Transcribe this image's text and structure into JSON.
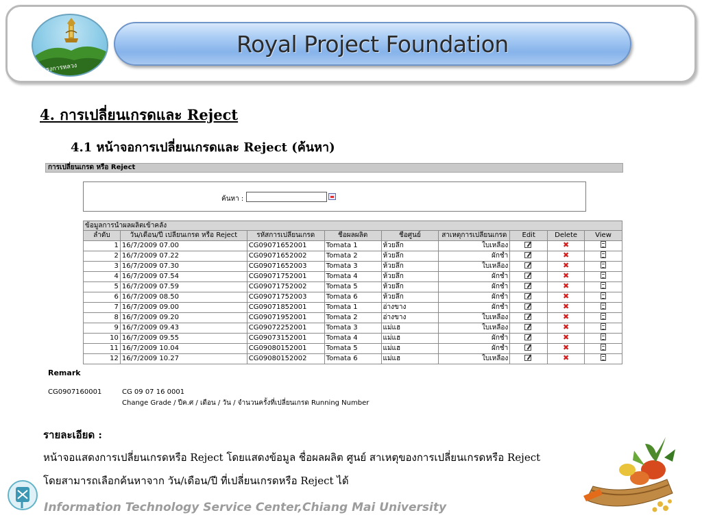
{
  "header": {
    "title": "Royal Project Foundation",
    "logo_text": "โครงการหลวง"
  },
  "headings": {
    "main": "4. การเปลี่ยนเกรดและ Reject",
    "sub": "4.1 หน้าจอการเปลี่ยนเกรดและ Reject (ค้นหา)"
  },
  "capture": {
    "title": "การเปลี่ยนเกรด หรือ Reject",
    "search_label": "ค้นหา :",
    "search_value": "",
    "table_caption": "ข้อมูลการนำผลผลิตเข้าคลัง",
    "columns": [
      "ลำดับ",
      "วัน/เดือน/ปี เปลี่ยนเกรด หรือ Reject",
      "รหัสการเปลี่ยนเกรด",
      "ชื่อผลผลิต",
      "ชื่อศูนย์",
      "สาเหตุการเปลี่ยนเกรด",
      "Edit",
      "Delete",
      "View"
    ],
    "rows": [
      {
        "no": "1",
        "date": "16/7/2009 07.00",
        "code": "CG09071652001",
        "product": "Tomata 1",
        "center": "ห้วยลึก",
        "reason": "ใบเหลือง"
      },
      {
        "no": "2",
        "date": "16/7/2009 07.22",
        "code": "CG09071652002",
        "product": "Tomata 2",
        "center": "ห้วยลึก",
        "reason": "ผักช้ำ"
      },
      {
        "no": "3",
        "date": "16/7/2009 07.30",
        "code": "CG09071652003",
        "product": "Tomata 3",
        "center": "ห้วยลึก",
        "reason": "ใบเหลือง"
      },
      {
        "no": "4",
        "date": "16/7/2009 07.54",
        "code": "CG09071752001",
        "product": "Tomata 4",
        "center": "ห้วยลึก",
        "reason": "ผักช้ำ"
      },
      {
        "no": "5",
        "date": "16/7/2009 07.59",
        "code": "CG09071752002",
        "product": "Tomata 5",
        "center": "ห้วยลึก",
        "reason": "ผักช้ำ"
      },
      {
        "no": "6",
        "date": "16/7/2009 08.50",
        "code": "CG09071752003",
        "product": "Tomata 6",
        "center": "ห้วยลึก",
        "reason": "ผักช้ำ"
      },
      {
        "no": "7",
        "date": "16/7/2009 09.00",
        "code": "CG09071852001",
        "product": "Tomata 1",
        "center": "อ่างขาง",
        "reason": "ผักช้ำ"
      },
      {
        "no": "8",
        "date": "16/7/2009 09.20",
        "code": "CG09071952001",
        "product": "Tomata 2",
        "center": "อ่างขาง",
        "reason": "ใบเหลือง"
      },
      {
        "no": "9",
        "date": "16/7/2009 09.43",
        "code": "CG09072252001",
        "product": "Tomata 3",
        "center": "แม่แฮ",
        "reason": "ใบเหลือง"
      },
      {
        "no": "10",
        "date": "16/7/2009 09.55",
        "code": "CG09073152001",
        "product": "Tomata 4",
        "center": "แม่แฮ",
        "reason": "ผักช้ำ"
      },
      {
        "no": "11",
        "date": "16/7/2009 10.04",
        "code": "CG09080152001",
        "product": "Tomata 5",
        "center": "แม่แฮ",
        "reason": "ผักช้ำ"
      },
      {
        "no": "12",
        "date": "16/7/2009 10.27",
        "code": "CG09080152002",
        "product": "Tomata 6",
        "center": "แม่แฮ",
        "reason": "ใบเหลือง"
      }
    ]
  },
  "remark": {
    "title": "Remark",
    "code": "CG0907160001",
    "line1": "CG 09 07 16 0001",
    "line2": "Change Grade /  ปีค.ศ / เดือน / วัน / จำนวนครั้งที่เปลี่ยนเกรด Running Number"
  },
  "detail": {
    "title": "รายละเอียด :",
    "line1": "หน้าจอแสดงการเปลี่ยนเกรดหรือ Reject โดยแสดงข้อมูล ชื่อผลผลิต ศูนย์ สาเหตุของการเปลี่ยนเกรดหรือ Reject",
    "line2": "โดยสามารถเลือกค้นหาจาก วัน/เดือน/ปี ที่เปลี่ยนเกรดหรือ Reject ได้"
  },
  "footer": {
    "text": "Information Technology Service Center,Chiang Mai University"
  },
  "colors": {
    "title_bar": "#86b3ea",
    "header_border": "#b9b9b9",
    "delete_icon": "#d21f1f",
    "footer_text": "#9c9c9c"
  }
}
